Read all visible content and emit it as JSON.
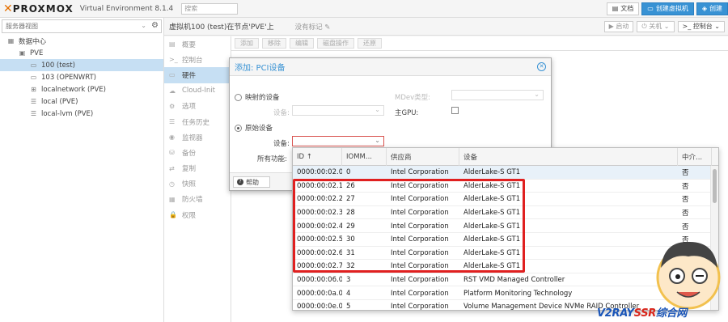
{
  "topbar": {
    "logo": "PROXMOX",
    "product": "Virtual Environment 8.1.4",
    "search_placeholder": "搜索",
    "docs": "文档",
    "create_vm": "创建虚拟机",
    "create_ct": "创建"
  },
  "tree": {
    "view": "服务器视图",
    "items": [
      {
        "label": "数据中心",
        "indent": 0,
        "icon": "datacenter-icon"
      },
      {
        "label": "PVE",
        "indent": 1,
        "icon": "node-icon"
      },
      {
        "label": "100 (test)",
        "indent": 2,
        "icon": "vm-icon",
        "selected": true
      },
      {
        "label": "103 (OPENWRT)",
        "indent": 2,
        "icon": "vm-icon"
      },
      {
        "label": "localnetwork (PVE)",
        "indent": 2,
        "icon": "network-icon"
      },
      {
        "label": "local (PVE)",
        "indent": 2,
        "icon": "storage-icon"
      },
      {
        "label": "local-lvm (PVE)",
        "indent": 2,
        "icon": "storage-icon"
      }
    ]
  },
  "vmheader": {
    "title": "虚拟机100 (test)在节点'PVE'上",
    "no_tags": "没有标记",
    "start": "启动",
    "shutdown": "关机",
    "console": "控制台"
  },
  "menu": [
    {
      "label": "概要",
      "icon": "summary-icon"
    },
    {
      "label": "控制台",
      "icon": "console-icon"
    },
    {
      "label": "硬件",
      "icon": "hardware-icon",
      "active": true
    },
    {
      "label": "Cloud-Init",
      "icon": "cloud-icon"
    },
    {
      "label": "选项",
      "icon": "options-icon"
    },
    {
      "label": "任务历史",
      "icon": "history-icon"
    },
    {
      "label": "监视器",
      "icon": "monitor-icon"
    },
    {
      "label": "备份",
      "icon": "backup-icon"
    },
    {
      "label": "复制",
      "icon": "replication-icon"
    },
    {
      "label": "快照",
      "icon": "snapshot-icon"
    },
    {
      "label": "防火墙",
      "icon": "firewall-icon"
    },
    {
      "label": "权限",
      "icon": "permissions-icon"
    }
  ],
  "hwbar": {
    "add": "添加",
    "remove": "移除",
    "edit": "编辑",
    "disk_action": "磁盘操作",
    "revert": "还原"
  },
  "dialog": {
    "title": "添加: PCI设备",
    "mapped_device": "映射的设备",
    "device_label": "设备:",
    "mdev_label": "MDev类型:",
    "primary_gpu": "主GPU:",
    "raw_device": "原始设备",
    "all_functions": "所有功能:",
    "help": "帮助"
  },
  "grid": {
    "headers": [
      "ID ↑",
      "IOMM...",
      "供应商",
      "设备",
      "中介..."
    ],
    "rows": [
      [
        "0000:00:02.0",
        "0",
        "Intel Corporation",
        "AlderLake-S GT1",
        "否"
      ],
      [
        "0000:00:02.1",
        "26",
        "Intel Corporation",
        "AlderLake-S GT1",
        "否"
      ],
      [
        "0000:00:02.2",
        "27",
        "Intel Corporation",
        "AlderLake-S GT1",
        "否"
      ],
      [
        "0000:00:02.3",
        "28",
        "Intel Corporation",
        "AlderLake-S GT1",
        "否"
      ],
      [
        "0000:00:02.4",
        "29",
        "Intel Corporation",
        "AlderLake-S GT1",
        "否"
      ],
      [
        "0000:00:02.5",
        "30",
        "Intel Corporation",
        "AlderLake-S GT1",
        "否"
      ],
      [
        "0000:00:02.6",
        "31",
        "Intel Corporation",
        "AlderLake-S GT1",
        "否"
      ],
      [
        "0000:00:02.7",
        "32",
        "Intel Corporation",
        "AlderLake-S GT1",
        "否"
      ],
      [
        "0000:00:06.0",
        "3",
        "Intel Corporation",
        "RST VMD Managed Controller",
        ""
      ],
      [
        "0000:00:0a.0",
        "4",
        "Intel Corporation",
        "Platform Monitoring Technology",
        ""
      ],
      [
        "0000:00:0e.0",
        "5",
        "Intel Corporation",
        "Volume Management Device NVMe RAID Controller",
        ""
      ]
    ]
  },
  "watermark": {
    "prefix": "V2RAY",
    "brand": "SSR",
    "suffix": "综合网"
  },
  "colors": {
    "accent": "#3892d4",
    "logo_orange": "#e57000",
    "highlight_red": "#e02020"
  }
}
